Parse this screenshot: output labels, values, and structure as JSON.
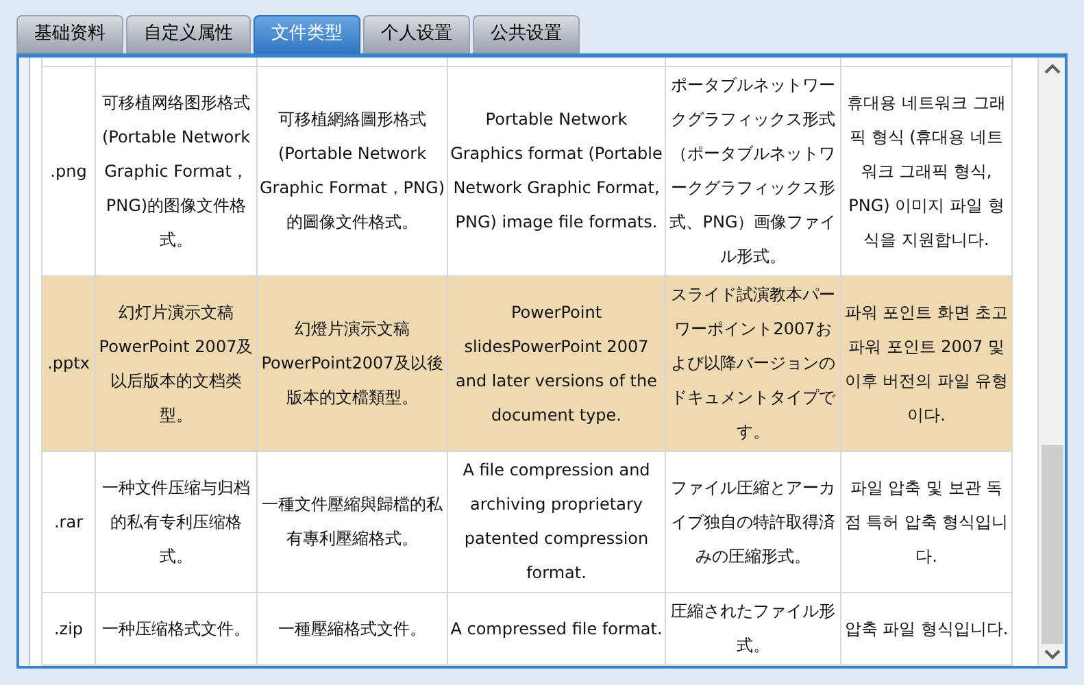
{
  "tabs": [
    {
      "label": "基础资料",
      "selected": false
    },
    {
      "label": "自定义属性",
      "selected": false
    },
    {
      "label": "文件类型",
      "selected": true
    },
    {
      "label": "个人设置",
      "selected": false
    },
    {
      "label": "公共设置",
      "selected": false
    }
  ],
  "table": {
    "rows": [
      {
        "selected": false,
        "cells": [
          ".png",
          "可移植网络图形格式(Portable Network Graphic Format，PNG)的图像文件格式。",
          "可移植網絡圖形格式(Portable Network Graphic Format，PNG)的圖像文件格式。",
          "Portable Network Graphics format (Portable Network Graphic Format, PNG) image file formats.",
          "ポータブルネットワークグラフィックス形式（ポータブルネットワークグラフィックス形式、PNG）画像ファイル形式。",
          "휴대용 네트워크 그래픽 형식 (휴대용 네트워크 그래픽 형식, PNG) 이미지 파일 형식을 지원합니다."
        ]
      },
      {
        "selected": true,
        "cells": [
          ".pptx",
          "幻灯片演示文稿PowerPoint 2007及以后版本的文档类型。",
          "幻燈片演示文稿PowerPoint2007及以後版本的文檔類型。",
          "PowerPoint slidesPowerPoint 2007 and later versions of the document type.",
          "スライド試演教本パーワーポイント2007および以降バージョンのドキュメントタイプです。",
          "파워 포인트 화면 초고 파워 포인트 2007 및 이후 버전의 파일 유형 이다."
        ]
      },
      {
        "selected": false,
        "cells": [
          ".rar",
          "一种文件压缩与归档的私有专利压缩格式。",
          "一種文件壓縮與歸檔的私有專利壓縮格式。",
          "A file compression and archiving proprietary patented compression format.",
          "ファイル圧縮とアーカイブ独自の特許取得済みの圧縮形式。",
          "파일 압축 및 보관 독점 특허 압축 형식입니다."
        ]
      },
      {
        "selected": false,
        "cells": [
          ".zip",
          "一种压缩格式文件。",
          "一種壓縮格式文件。",
          "A compressed file format.",
          "圧縮されたファイル形式。",
          "압축 파일 형식입니다."
        ]
      }
    ]
  }
}
